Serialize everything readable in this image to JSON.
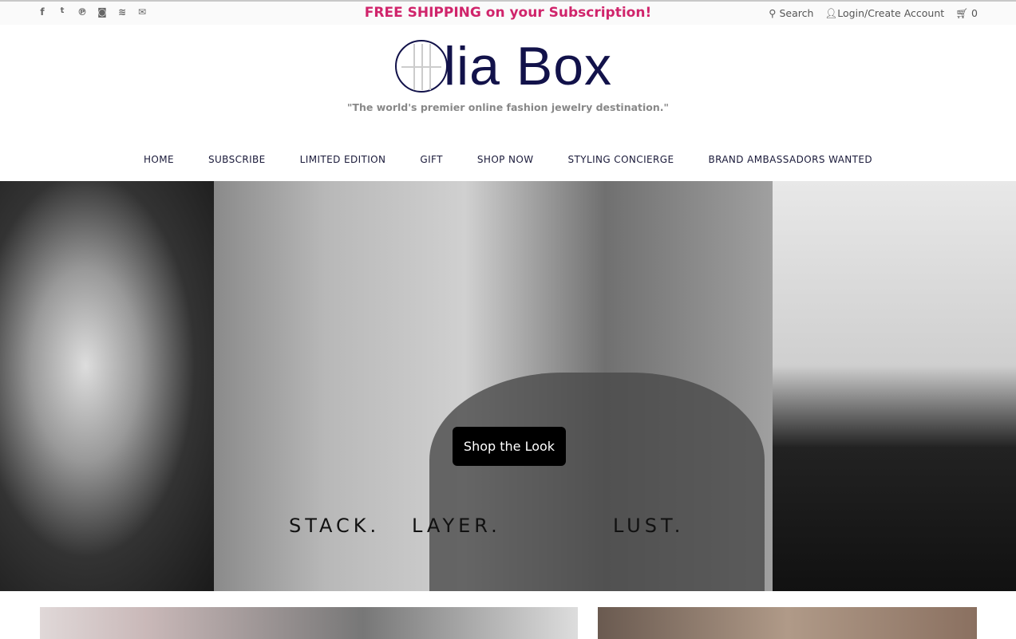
{
  "topbar": {
    "social": [
      {
        "icon": "facebook-icon",
        "glyph": "f"
      },
      {
        "icon": "twitter-icon",
        "glyph": "🐦"
      },
      {
        "icon": "pinterest-icon",
        "glyph": "℗"
      },
      {
        "icon": "instagram-icon",
        "glyph": "◙"
      },
      {
        "icon": "rss-icon",
        "glyph": "≋"
      },
      {
        "icon": "email-icon",
        "glyph": "✉"
      }
    ],
    "promo": "FREE SHIPPING on your Subscription!",
    "search": "Search",
    "login": "Login/Create Account",
    "cart_count": "0"
  },
  "brand": {
    "name": "Olia Box",
    "logo_text": "lia Box",
    "tagline": "\"The world's premier online fashion jewelry destination.\""
  },
  "nav": [
    "HOME",
    "SUBSCRIBE",
    "LIMITED EDITION",
    "GIFT",
    "SHOP NOW",
    "STYLING CONCIERGE",
    "BRAND AMBASSADORS WANTED"
  ],
  "hero": {
    "button": "Shop the Look",
    "words": [
      "STACK.",
      "LAYER.",
      "LUST."
    ]
  },
  "colors": {
    "promo": "#d0246b",
    "brand": "#12124a"
  }
}
